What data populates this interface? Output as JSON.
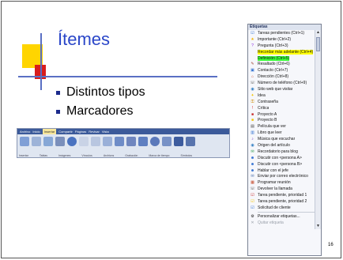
{
  "slide": {
    "title": "Ítemes",
    "bullets": [
      "Distintos tipos",
      "Marcadores"
    ],
    "page_number": "16"
  },
  "ribbon": {
    "tabs": [
      "Archivo",
      "Inicio",
      "Insertar",
      "Compartir",
      "Páginas",
      "Revisar",
      "Vista"
    ],
    "active_tab": "Insertar",
    "groups": [
      "Insertar",
      "Tablas",
      "Imágenes",
      "Vínculos",
      "Archivos",
      "Grabación",
      "Marca de tiempo",
      "Símbolos"
    ]
  },
  "menu": {
    "header": "Etiquetas",
    "items": [
      {
        "label": "Tareas pendientes (Ctrl+1)",
        "icon": "checkbox-icon",
        "color": "#2f6fd1"
      },
      {
        "label": "Importante (Ctrl+2)",
        "icon": "star-icon",
        "color": "#f4b400"
      },
      {
        "label": "Pregunta (Ctrl+3)",
        "icon": "question-icon",
        "color": "#8a2be2"
      },
      {
        "label": "Recordar más adelante (Ctrl+4)",
        "icon": "blank-icon",
        "highlight": "yellow"
      },
      {
        "label": "Definición (Ctrl+5)",
        "icon": "blank-icon",
        "highlight": "green"
      },
      {
        "label": "Resaltado (Ctrl+6)",
        "icon": "pen-icon",
        "color": "#9c3d2d"
      },
      {
        "label": "Contacto (Ctrl+7)",
        "icon": "contact-icon",
        "color": "#2f6fd1"
      },
      {
        "label": "Dirección (Ctrl+8)",
        "icon": "house-icon",
        "color": "#c64b2c"
      },
      {
        "label": "Número de teléfono (Ctrl+9)",
        "icon": "phone-icon",
        "color": "#555555"
      },
      {
        "label": "Sitio web que visitar",
        "icon": "globe-icon",
        "color": "#2a7ac0"
      },
      {
        "label": "Idea",
        "icon": "bulb-icon",
        "color": "#f4c400"
      },
      {
        "label": "Contraseña",
        "icon": "key-icon",
        "color": "#cc8800"
      },
      {
        "label": "Crítica",
        "icon": "exclamation-icon",
        "color": "#d62020"
      },
      {
        "label": "Proyecto A",
        "icon": "square-icon",
        "color": "#c82a2a"
      },
      {
        "label": "Proyecto B",
        "icon": "square-icon",
        "color": "#f4c400"
      },
      {
        "label": "Película que ver",
        "icon": "film-icon",
        "color": "#444444"
      },
      {
        "label": "Libro que leer",
        "icon": "book-icon",
        "color": "#2f6fd1"
      },
      {
        "label": "Música que escuchar",
        "icon": "music-icon",
        "color": "#6a2dbf"
      },
      {
        "label": "Origen del artículo",
        "icon": "globe-icon",
        "color": "#2a7ac0"
      },
      {
        "label": "Recordatorio para blog",
        "icon": "blog-icon",
        "color": "#2a9a4a"
      },
      {
        "label": "Discutir con <persona A>",
        "icon": "people-icon",
        "color": "#2f6fd1"
      },
      {
        "label": "Discutir con <persona B>",
        "icon": "people-icon",
        "color": "#2f6fd1"
      },
      {
        "label": "Hablar con el jefe",
        "icon": "people-icon",
        "color": "#2f6fd1"
      },
      {
        "label": "Enviar por correo electrónico",
        "icon": "mail-icon",
        "color": "#4a6da8"
      },
      {
        "label": "Programar reunión",
        "icon": "calendar-icon",
        "color": "#c64b2c"
      },
      {
        "label": "Devolver la llamada",
        "icon": "phone-icon",
        "color": "#555555"
      },
      {
        "label": "Tarea pendiente, prioridad 1",
        "icon": "checkbox-icon",
        "color": "#c82a2a"
      },
      {
        "label": "Tarea pendiente, prioridad 2",
        "icon": "checkbox-icon",
        "color": "#f4c400"
      },
      {
        "label": "Solicitud de cliente",
        "icon": "checkbox-icon",
        "color": "#2f6fd1"
      }
    ],
    "footer": [
      {
        "label": "Personalizar etiquetas...",
        "icon": "customize-icon",
        "disabled": false
      },
      {
        "label": "Quitar etiqueta",
        "icon": "remove-icon",
        "disabled": true
      }
    ]
  }
}
